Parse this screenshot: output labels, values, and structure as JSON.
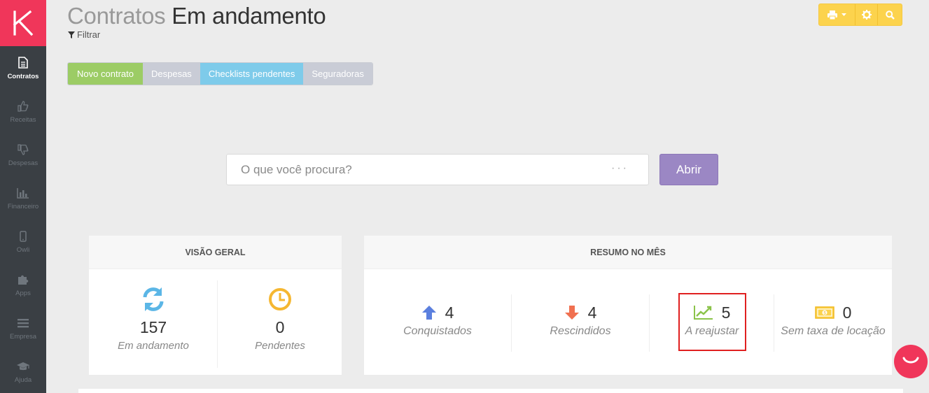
{
  "sidebar": {
    "items": [
      {
        "label": "Contratos",
        "icon": "document-icon",
        "active": true
      },
      {
        "label": "Receitas",
        "icon": "thumbs-up-icon"
      },
      {
        "label": "Despesas",
        "icon": "thumbs-down-icon"
      },
      {
        "label": "Financeiro",
        "icon": "bar-chart-icon"
      },
      {
        "label": "Owli",
        "icon": "mobile-icon"
      },
      {
        "label": "Apps",
        "icon": "puzzle-icon"
      },
      {
        "label": "Empresa",
        "icon": "menu-icon"
      },
      {
        "label": "Ajuda",
        "icon": "graduation-cap-icon"
      }
    ]
  },
  "header": {
    "title_part1": "Contratos",
    "title_part2": "Em andamento",
    "filter_label": "Filtrar"
  },
  "tabs": [
    {
      "label": "Novo contrato"
    },
    {
      "label": "Despesas"
    },
    {
      "label": "Checklists pendentes"
    },
    {
      "label": "Seguradoras"
    }
  ],
  "search": {
    "placeholder": "O que você procura?",
    "more": "···",
    "button_label": "Abrir"
  },
  "overview": {
    "title": "VISÃO GERAL",
    "stats": [
      {
        "value": "157",
        "label": "Em andamento",
        "icon": "refresh-icon"
      },
      {
        "value": "0",
        "label": "Pendentes",
        "icon": "clock-icon"
      }
    ]
  },
  "month_summary": {
    "title": "RESUMO NO MÊS",
    "stats": [
      {
        "value": "4",
        "label": "Conquistados",
        "icon": "arrow-up-icon"
      },
      {
        "value": "4",
        "label": "Rescindidos",
        "icon": "arrow-down-icon"
      },
      {
        "value": "5",
        "label": "A reajustar",
        "icon": "trend-chart-icon"
      },
      {
        "value": "0",
        "label": "Sem taxa de locação",
        "icon": "money-icon"
      }
    ]
  },
  "colors": {
    "brand": "#f0365a",
    "sidebar": "#3a3f44",
    "tab_green": "#9ccc65",
    "tab_blue": "#7ecbea",
    "button_purple": "#9b87c4",
    "toolbar_yellow": "#fcd34d"
  }
}
